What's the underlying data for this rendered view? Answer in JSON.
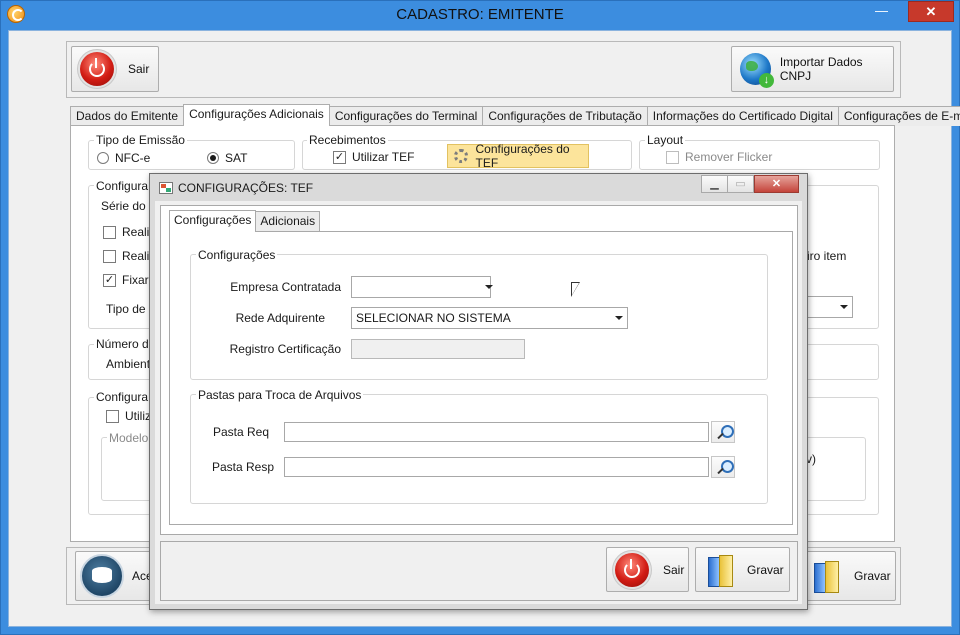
{
  "window": {
    "title": "CADASTRO: EMITENTE",
    "min": "—",
    "max": "▭",
    "close": "✕"
  },
  "toolbar": {
    "sair": "Sair",
    "importar": "Importar Dados CNPJ"
  },
  "tabs": [
    "Dados do Emitente",
    "Configurações Adicionais",
    "Configurações do Terminal",
    "Configurações de Tributação",
    "Informações do Certificado Digital",
    "Configurações de E-mail"
  ],
  "tipo_emissao": {
    "label": "Tipo de Emissão",
    "nfce": "NFC-e",
    "sat": "SAT",
    "selected": "SAT"
  },
  "recebimentos": {
    "label": "Recebimentos",
    "utilizar_tef": "Utilizar TEF",
    "utilizar_tef_checked": true,
    "config_tef": "Configurações do TEF"
  },
  "layout": {
    "label": "Layout",
    "remover_flicker": "Remover Flicker"
  },
  "bg_partial": {
    "configura1": "Configura",
    "serie": "Série do D",
    "realiz1": "Realiz",
    "realiz2": "Realiz",
    "fixar": "Fixar i",
    "tipo": "Tipo de P",
    "numero": "Número da",
    "ambiente": "Ambiente",
    "configura2": "Configura",
    "utiliz": "Utiliz",
    "modelo": "Modelo d",
    "iro_item": "iro item",
    "v": "v)"
  },
  "bottom": {
    "acessar": "Ace",
    "gravar": "Gravar"
  },
  "dialog": {
    "title": "CONFIGURAÇÕES: TEF",
    "tabs": [
      "Configurações",
      "Adicionais"
    ],
    "group1": "Configurações",
    "empresa_label": "Empresa Contratada",
    "empresa_value": "",
    "rede_label": "Rede Adquirente",
    "rede_value": "SELECIONAR NO SISTEMA",
    "registro_label": "Registro Certificação",
    "registro_value": "",
    "group2": "Pastas para Troca de Arquivos",
    "pasta_req_label": "Pasta Req",
    "pasta_resp_label": "Pasta Resp",
    "sair": "Sair",
    "gravar": "Gravar"
  }
}
